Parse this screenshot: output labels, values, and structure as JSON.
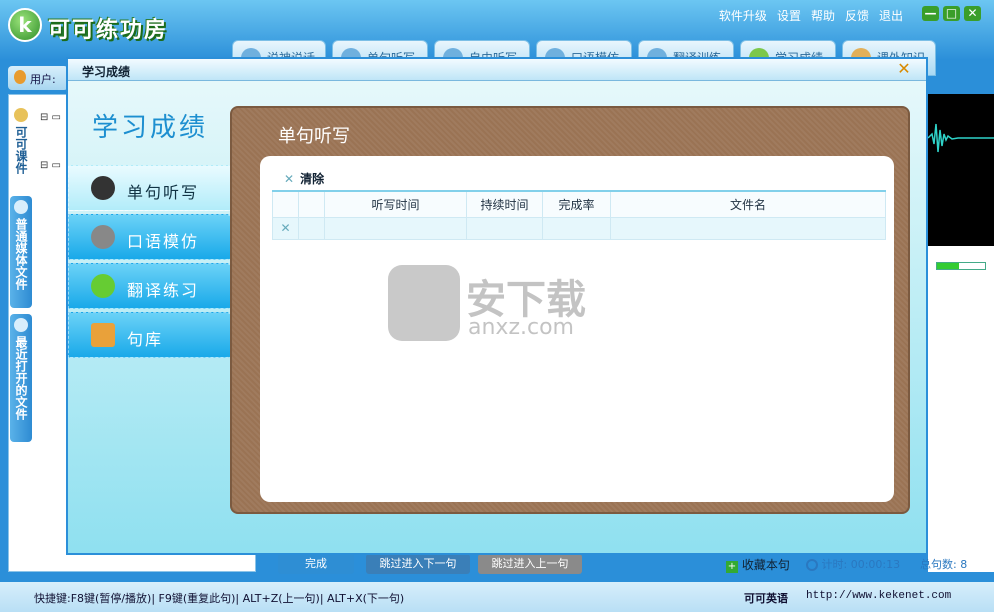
{
  "app": {
    "title": "可可练功房",
    "logo_letter": "k",
    "menu": [
      "软件升级",
      "设置",
      "帮助",
      "反馈",
      "退出"
    ],
    "window_controls": {
      "minimize": "—",
      "maximize": "□",
      "close": "✕"
    },
    "nav_tabs": [
      "说神说话",
      "单句听写",
      "自由听写",
      "口语模仿",
      "翻译训练",
      "学习成绩",
      "课外知识"
    ],
    "user_label": "用户:",
    "side_tabs": [
      "可可课件",
      "普通媒体文件",
      "最近打开的文件"
    ]
  },
  "dialog": {
    "title": "学习成绩",
    "close": "✕",
    "big_title": "学习成绩",
    "menu": [
      {
        "label": "单句听写",
        "icon": "headphones-icon",
        "active": true
      },
      {
        "label": "口语模仿",
        "icon": "microphone-icon",
        "active": false
      },
      {
        "label": "翻译练习",
        "icon": "person-icon",
        "active": false
      },
      {
        "label": "句库",
        "icon": "books-icon",
        "active": false
      }
    ],
    "panel_title": "单句听写",
    "clear_label": "清除",
    "table": {
      "headers": [
        "",
        "",
        "听写时间",
        "持续时间",
        "完成率",
        "文件名"
      ],
      "rows": [
        [
          "✕",
          "",
          "",
          "",
          "",
          ""
        ]
      ]
    }
  },
  "bottom": {
    "done_button": "完成",
    "next_button": "跳过进入下一句",
    "prev_button": "跳过进入上一句",
    "bookmark_label": "收藏本句",
    "timer_label": "计时: 00:00:13",
    "total_label": "总句数: 8"
  },
  "status": {
    "shortcuts": "快捷键:F8键(暂停/播放)| F9键(重复此句)| ALT+Z(上一句)| ALT+X(下一句)",
    "brand": "可可英语",
    "url": "http://www.kekenet.com"
  },
  "watermark": {
    "text": "安下载",
    "sub": "anxz.com"
  },
  "colors": {
    "accent": "#2b8fd9",
    "board": "#9a7354",
    "menu_blue": "#19a9e9"
  }
}
